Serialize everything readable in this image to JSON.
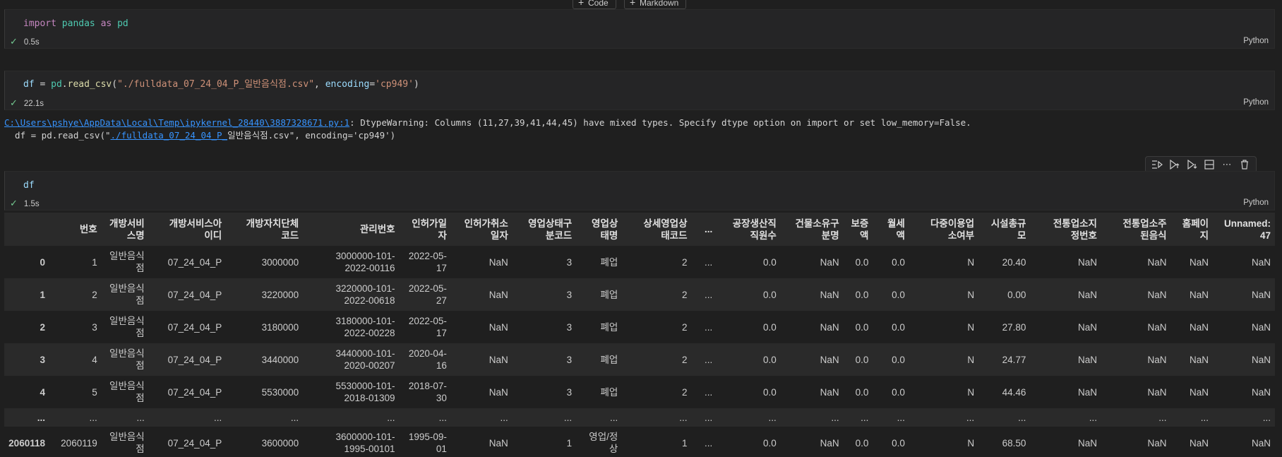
{
  "add_bar": {
    "code_label": "Code",
    "markdown_label": "Markdown"
  },
  "cells": [
    {
      "code": "import pandas as pd",
      "time": "0.5s",
      "lang": "Python"
    },
    {
      "code": "df = pd.read_csv(\"./fulldata_07_24_04_P_일반음식점.csv\", encoding='cp949')",
      "time": "22.1s",
      "lang": "Python"
    },
    {
      "code": "df",
      "time": "1.5s",
      "lang": "Python"
    }
  ],
  "warning": {
    "link": "C:\\Users\\pshye\\AppData\\Local\\Temp\\ipykernel_28440\\3887328671.py:1",
    "message": ": DtypeWarning: Columns (11,27,39,41,44,45) have mixed types. Specify dtype option on import or set low_memory=False.",
    "line2_prefix": "  df = pd.read_csv(\"",
    "line2_link": "./fulldata_07_24_04_P_",
    "line2_suffix": "일반음식점.csv\", encoding='cp949')"
  },
  "cell_toolbar": [
    "run-by-line-icon",
    "execute-above-icon",
    "execute-below-icon",
    "split-cell-icon",
    "more-icon",
    "delete-icon"
  ],
  "table": {
    "columns": [
      "",
      "번호",
      "개방서비\n스명",
      "개방서비스아\n이디",
      "개방자치단체\n코드",
      "관리번호",
      "인허가일\n자",
      "인허가취소\n일자",
      "영업상태구\n분코드",
      "영업상\n태명",
      "상세영업상\n태코드",
      "...",
      "공장생산직\n직원수",
      "건물소유구\n분명",
      "보증\n액",
      "월세\n액",
      "다중이용업\n소여부",
      "시설총규\n모",
      "전통업소지\n정번호",
      "전통업소주\n된음식",
      "홈페이\n지",
      "Unnamed:\n47"
    ],
    "rows": [
      [
        "0",
        "1",
        "일반음식\n점",
        "07_24_04_P",
        "3000000",
        "3000000-101-\n2022-00116",
        "2022-05-\n17",
        "NaN",
        "3",
        "폐업",
        "2",
        "...",
        "0.0",
        "NaN",
        "0.0",
        "0.0",
        "N",
        "20.40",
        "NaN",
        "NaN",
        "NaN",
        "NaN"
      ],
      [
        "1",
        "2",
        "일반음식\n점",
        "07_24_04_P",
        "3220000",
        "3220000-101-\n2022-00618",
        "2022-05-\n27",
        "NaN",
        "3",
        "폐업",
        "2",
        "...",
        "0.0",
        "NaN",
        "0.0",
        "0.0",
        "N",
        "0.00",
        "NaN",
        "NaN",
        "NaN",
        "NaN"
      ],
      [
        "2",
        "3",
        "일반음식\n점",
        "07_24_04_P",
        "3180000",
        "3180000-101-\n2022-00228",
        "2022-05-\n17",
        "NaN",
        "3",
        "폐업",
        "2",
        "...",
        "0.0",
        "NaN",
        "0.0",
        "0.0",
        "N",
        "27.80",
        "NaN",
        "NaN",
        "NaN",
        "NaN"
      ],
      [
        "3",
        "4",
        "일반음식\n점",
        "07_24_04_P",
        "3440000",
        "3440000-101-\n2020-00207",
        "2020-04-\n16",
        "NaN",
        "3",
        "폐업",
        "2",
        "...",
        "0.0",
        "NaN",
        "0.0",
        "0.0",
        "N",
        "24.77",
        "NaN",
        "NaN",
        "NaN",
        "NaN"
      ],
      [
        "4",
        "5",
        "일반음식\n점",
        "07_24_04_P",
        "5530000",
        "5530000-101-\n2018-01309",
        "2018-07-\n30",
        "NaN",
        "3",
        "폐업",
        "2",
        "...",
        "0.0",
        "NaN",
        "0.0",
        "0.0",
        "N",
        "44.46",
        "NaN",
        "NaN",
        "NaN",
        "NaN"
      ],
      [
        "...",
        "...",
        "...",
        "...",
        "...",
        "...",
        "...",
        "...",
        "...",
        "...",
        "...",
        "...",
        "...",
        "...",
        "...",
        "...",
        "...",
        "...",
        "...",
        "...",
        "...",
        "..."
      ],
      [
        "2060118",
        "2060119",
        "일반음식\n점",
        "07_24_04_P",
        "3600000",
        "3600000-101-\n1995-00101",
        "1995-09-\n01",
        "NaN",
        "1",
        "영업/정\n상",
        "1",
        "...",
        "0.0",
        "NaN",
        "0.0",
        "0.0",
        "N",
        "68.50",
        "NaN",
        "NaN",
        "NaN",
        "NaN"
      ]
    ]
  }
}
